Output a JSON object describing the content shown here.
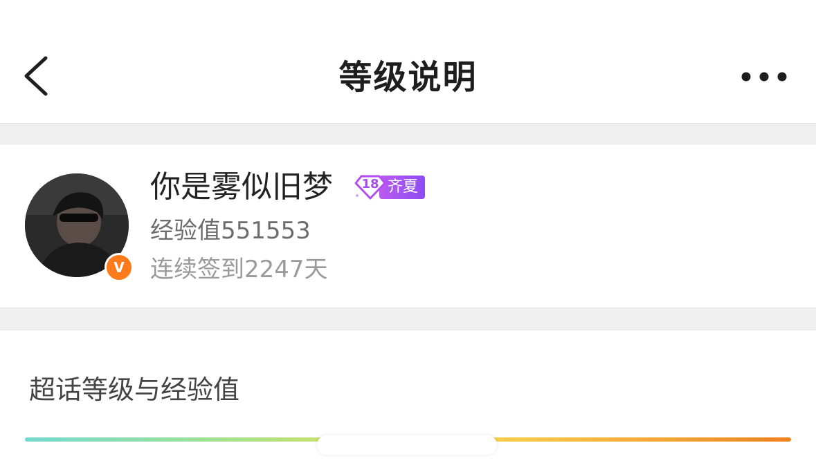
{
  "nav": {
    "title": "等级说明",
    "back_icon": "chevron-left-icon",
    "more_icon": "more-dots-icon"
  },
  "profile": {
    "username": "你是雾似旧梦",
    "level_number": "18",
    "level_tag": "齐夏",
    "experience": "经验值551553",
    "checkin": "连续签到2247天",
    "verified_badge": "V",
    "avatar_icon": "user-avatar"
  },
  "section": {
    "title": "超话等级与经验值"
  },
  "colors": {
    "badge_purple": "#9b4ff2",
    "verified_orange": "#ff7a1a",
    "progress_start": "#74d8d0",
    "progress_end": "#ee7f1f"
  }
}
